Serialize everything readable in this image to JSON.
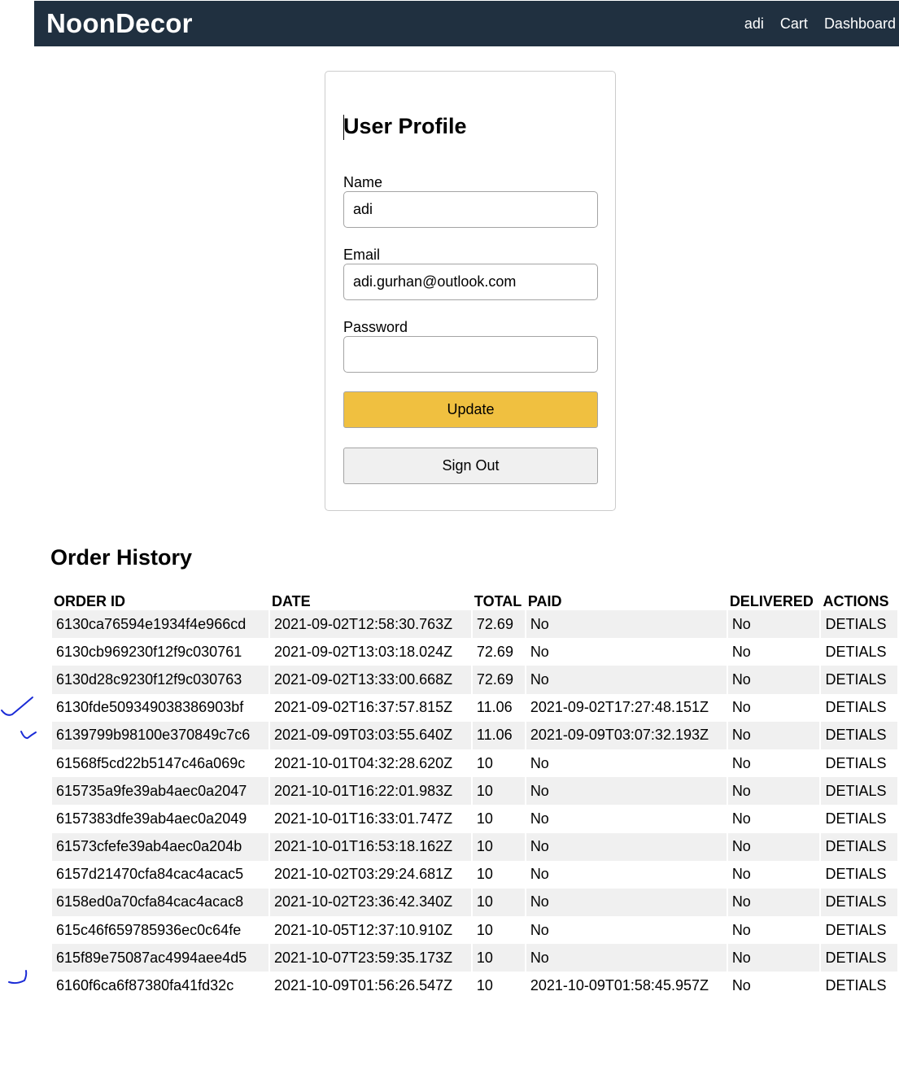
{
  "navbar": {
    "brand": "NoonDecor",
    "links": [
      "adi",
      "Cart",
      "Dashboard"
    ]
  },
  "profile": {
    "title": "User Profile",
    "name_label": "Name",
    "name_value": "adi",
    "email_label": "Email",
    "email_value": "adi.gurhan@outlook.com",
    "password_label": "Password",
    "password_value": "",
    "update_label": "Update",
    "signout_label": "Sign Out"
  },
  "orders": {
    "title": "Order History",
    "columns": [
      "ORDER ID",
      "DATE",
      "TOTAL",
      "PAID",
      "DELIVERED",
      "ACTIONS"
    ],
    "rows": [
      {
        "id": "6130ca76594e1934f4e966cd",
        "date": "2021-09-02T12:58:30.763Z",
        "total": "72.69",
        "paid": "No",
        "delivered": "No",
        "action": "DETIALS"
      },
      {
        "id": "6130cb969230f12f9c030761",
        "date": "2021-09-02T13:03:18.024Z",
        "total": "72.69",
        "paid": "No",
        "delivered": "No",
        "action": "DETIALS"
      },
      {
        "id": "6130d28c9230f12f9c030763",
        "date": "2021-09-02T13:33:00.668Z",
        "total": "72.69",
        "paid": "No",
        "delivered": "No",
        "action": "DETIALS"
      },
      {
        "id": "6130fde509349038386903bf",
        "date": "2021-09-02T16:37:57.815Z",
        "total": "11.06",
        "paid": "2021-09-02T17:27:48.151Z",
        "delivered": "No",
        "action": "DETIALS"
      },
      {
        "id": "6139799b98100e370849c7c6",
        "date": "2021-09-09T03:03:55.640Z",
        "total": "11.06",
        "paid": "2021-09-09T03:07:32.193Z",
        "delivered": "No",
        "action": "DETIALS"
      },
      {
        "id": "61568f5cd22b5147c46a069c",
        "date": "2021-10-01T04:32:28.620Z",
        "total": "10",
        "paid": "No",
        "delivered": "No",
        "action": "DETIALS"
      },
      {
        "id": "615735a9fe39ab4aec0a2047",
        "date": "2021-10-01T16:22:01.983Z",
        "total": "10",
        "paid": "No",
        "delivered": "No",
        "action": "DETIALS"
      },
      {
        "id": "6157383dfe39ab4aec0a2049",
        "date": "2021-10-01T16:33:01.747Z",
        "total": "10",
        "paid": "No",
        "delivered": "No",
        "action": "DETIALS"
      },
      {
        "id": "61573cfefe39ab4aec0a204b",
        "date": "2021-10-01T16:53:18.162Z",
        "total": "10",
        "paid": "No",
        "delivered": "No",
        "action": "DETIALS"
      },
      {
        "id": "6157d21470cfa84cac4acac5",
        "date": "2021-10-02T03:29:24.681Z",
        "total": "10",
        "paid": "No",
        "delivered": "No",
        "action": "DETIALS"
      },
      {
        "id": "6158ed0a70cfa84cac4acac8",
        "date": "2021-10-02T23:36:42.340Z",
        "total": "10",
        "paid": "No",
        "delivered": "No",
        "action": "DETIALS"
      },
      {
        "id": "615c46f659785936ec0c64fe",
        "date": "2021-10-05T12:37:10.910Z",
        "total": "10",
        "paid": "No",
        "delivered": "No",
        "action": "DETIALS"
      },
      {
        "id": "615f89e75087ac4994aee4d5",
        "date": "2021-10-07T23:59:35.173Z",
        "total": "10",
        "paid": "No",
        "delivered": "No",
        "action": "DETIALS"
      },
      {
        "id": "6160f6ca6f87380fa41fd32c",
        "date": "2021-10-09T01:56:26.547Z",
        "total": "10",
        "paid": "2021-10-09T01:58:45.957Z",
        "delivered": "No",
        "action": "DETIALS"
      }
    ]
  },
  "annotations": {
    "ink_color": "#1a2bd6",
    "check_icons": [
      "hand-drawn-check-icon",
      "hand-drawn-check-icon",
      "hand-drawn-check-icon"
    ]
  }
}
